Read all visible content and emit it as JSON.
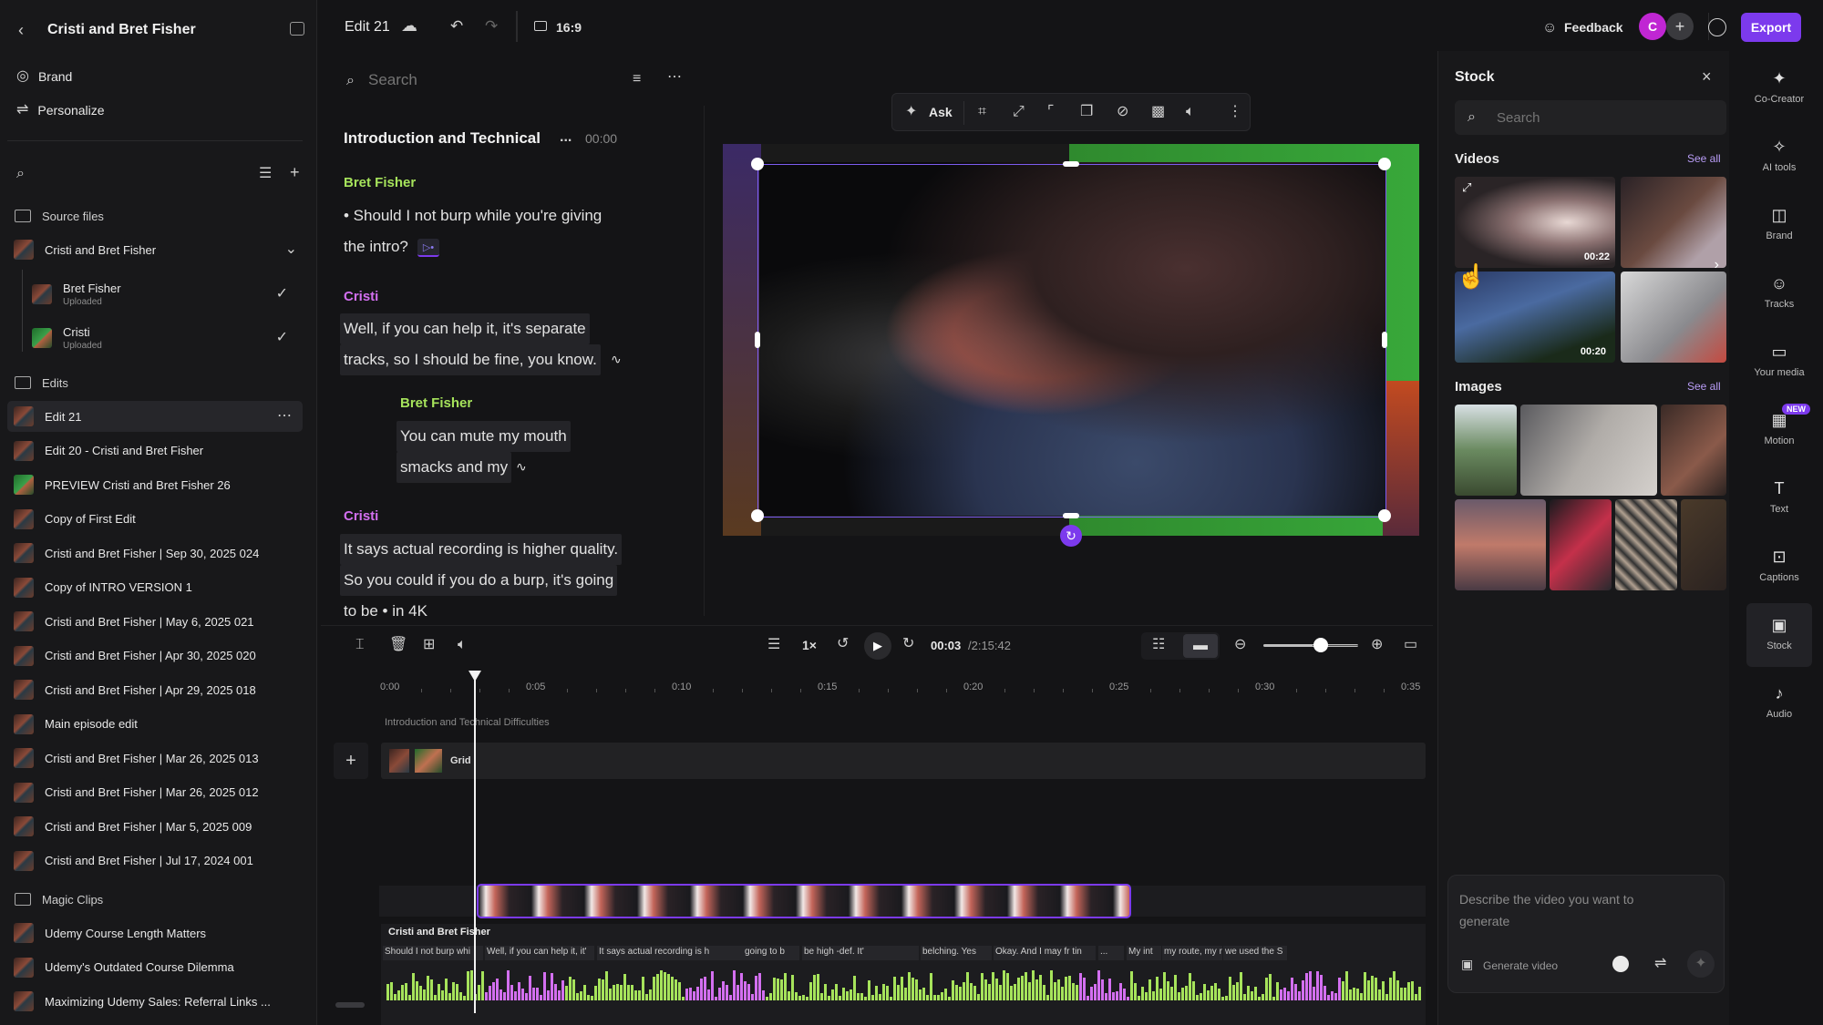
{
  "sidebar": {
    "title": "Cristi and Bret Fisher",
    "brand": "Brand",
    "personalize": "Personalize",
    "source_files": "Source files",
    "source_group": "Cristi and Bret Fisher",
    "sources": [
      {
        "name": "Bret Fisher",
        "status": "Uploaded"
      },
      {
        "name": "Cristi",
        "status": "Uploaded"
      }
    ],
    "edits_label": "Edits",
    "edits": [
      "Edit 21",
      "Edit 20 - Cristi and Bret Fisher",
      "PREVIEW Cristi and Bret Fisher 26",
      "Copy of First Edit",
      "Cristi and Bret Fisher | Sep 30, 2025 024",
      "Copy of INTRO VERSION 1",
      "Cristi and Bret Fisher | May 6, 2025 021",
      "Cristi and Bret Fisher | Apr 30, 2025 020",
      "Cristi and Bret Fisher | Apr 29, 2025 018",
      "Main episode edit",
      "Cristi and Bret Fisher | Mar 26, 2025 013",
      "Cristi and Bret Fisher | Mar 26, 2025 012",
      "Cristi and Bret Fisher | Mar 5, 2025 009",
      "Cristi and Bret Fisher | Jul 17, 2024 001"
    ],
    "magic_label": "Magic Clips",
    "magic": [
      "Udemy Course Length Matters",
      "Udemy's Outdated Course Dilemma",
      "Maximizing Udemy Sales: Referral Links ..."
    ]
  },
  "topbar": {
    "edit_name": "Edit 21",
    "ratio": "16:9",
    "feedback": "Feedback",
    "avatar": "C",
    "export": "Export"
  },
  "script": {
    "search_placeholder": "Search",
    "chapter": "Introduction and Technical",
    "chapter_more": "...",
    "chapter_time": "00:00",
    "blocks": [
      {
        "speaker": "Bret Fisher",
        "lines": [
          "• Should I not burp while you're giving",
          "the intro?"
        ]
      },
      {
        "speaker": "Cristi",
        "lines": [
          "Well, if you can help it, it's separate",
          "tracks, so I should be fine, you know."
        ]
      },
      {
        "speaker": "Bret Fisher",
        "lines": [
          "You can mute my mouth",
          "smacks and my"
        ]
      },
      {
        "speaker": "Cristi",
        "lines": [
          "It says actual recording is higher quality.",
          "So you could if you do a burp, it's going",
          "to be • in 4K"
        ]
      }
    ]
  },
  "canvas_toolbar": {
    "ask": "Ask"
  },
  "player": {
    "speed": "1×",
    "current": "00:03",
    "total": "/2:15:42"
  },
  "timeline": {
    "ticks": [
      "0:00",
      "0:05",
      "0:10",
      "0:15",
      "0:20",
      "0:25",
      "0:30",
      "0:35"
    ],
    "chapter_label": "Introduction and Technical Difficulties",
    "grid_label": "Grid",
    "track_label": "Cristi and Bret Fisher",
    "transcript_chunks": [
      "Should I not burp whi",
      "Well, if you can help it, it'",
      "It says actual recording is h",
      "going to b",
      "be high -def. It'",
      "belching. Yes",
      "Okay. And I may fr tin",
      "...",
      "My int",
      "my route, my route",
      "we used the S"
    ]
  },
  "stock": {
    "title": "Stock",
    "search_placeholder": "Search",
    "videos_label": "Videos",
    "images_label": "Images",
    "see_all": "See all",
    "video_durations": [
      "00:22",
      "00:20"
    ],
    "prompt_placeholder": "Describe the video you want to generate",
    "generate": "Generate video"
  },
  "rail": [
    {
      "icon": "co-creator-icon",
      "label": "Co-Creator"
    },
    {
      "icon": "ai-tools-icon",
      "label": "AI tools"
    },
    {
      "icon": "brand-icon",
      "label": "Brand"
    },
    {
      "icon": "tracks-icon",
      "label": "Tracks"
    },
    {
      "icon": "your-media-icon",
      "label": "Your media"
    },
    {
      "icon": "motion-icon",
      "label": "Motion",
      "badge": "NEW"
    },
    {
      "icon": "text-icon",
      "label": "Text"
    },
    {
      "icon": "captions-icon",
      "label": "Captions"
    },
    {
      "icon": "stock-icon",
      "label": "Stock"
    },
    {
      "icon": "audio-icon",
      "label": "Audio"
    }
  ],
  "colors": {
    "accent": "#7c3aed",
    "green": "#a6e35b",
    "pink": "#d36ff0"
  }
}
